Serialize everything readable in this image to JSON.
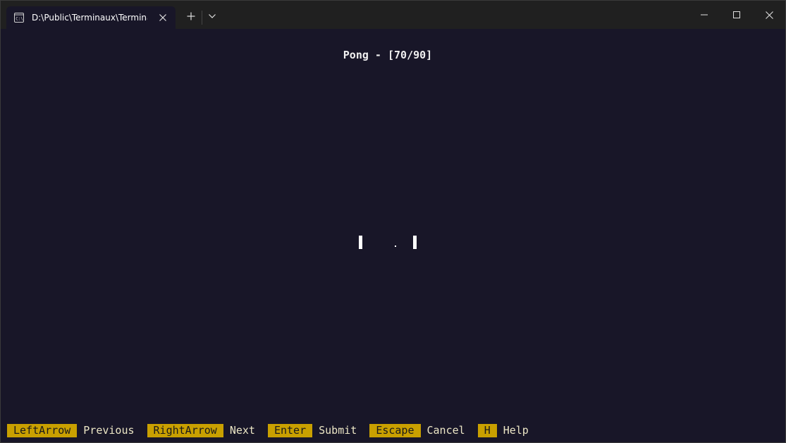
{
  "window": {
    "tab_title": "D:\\Public\\Terminaux\\Terminaux",
    "tab_icon": "terminal-icon"
  },
  "game": {
    "title": "Pong - [70/90]"
  },
  "keybindings": [
    {
      "key": "LeftArrow",
      "label": "Previous"
    },
    {
      "key": "RightArrow",
      "label": "Next"
    },
    {
      "key": "Enter",
      "label": "Submit"
    },
    {
      "key": "Escape",
      "label": "Cancel"
    },
    {
      "key": "H",
      "label": "Help"
    }
  ],
  "colors": {
    "background": "#181628",
    "key_highlight": "#c9a000",
    "titlebar": "#202020"
  }
}
